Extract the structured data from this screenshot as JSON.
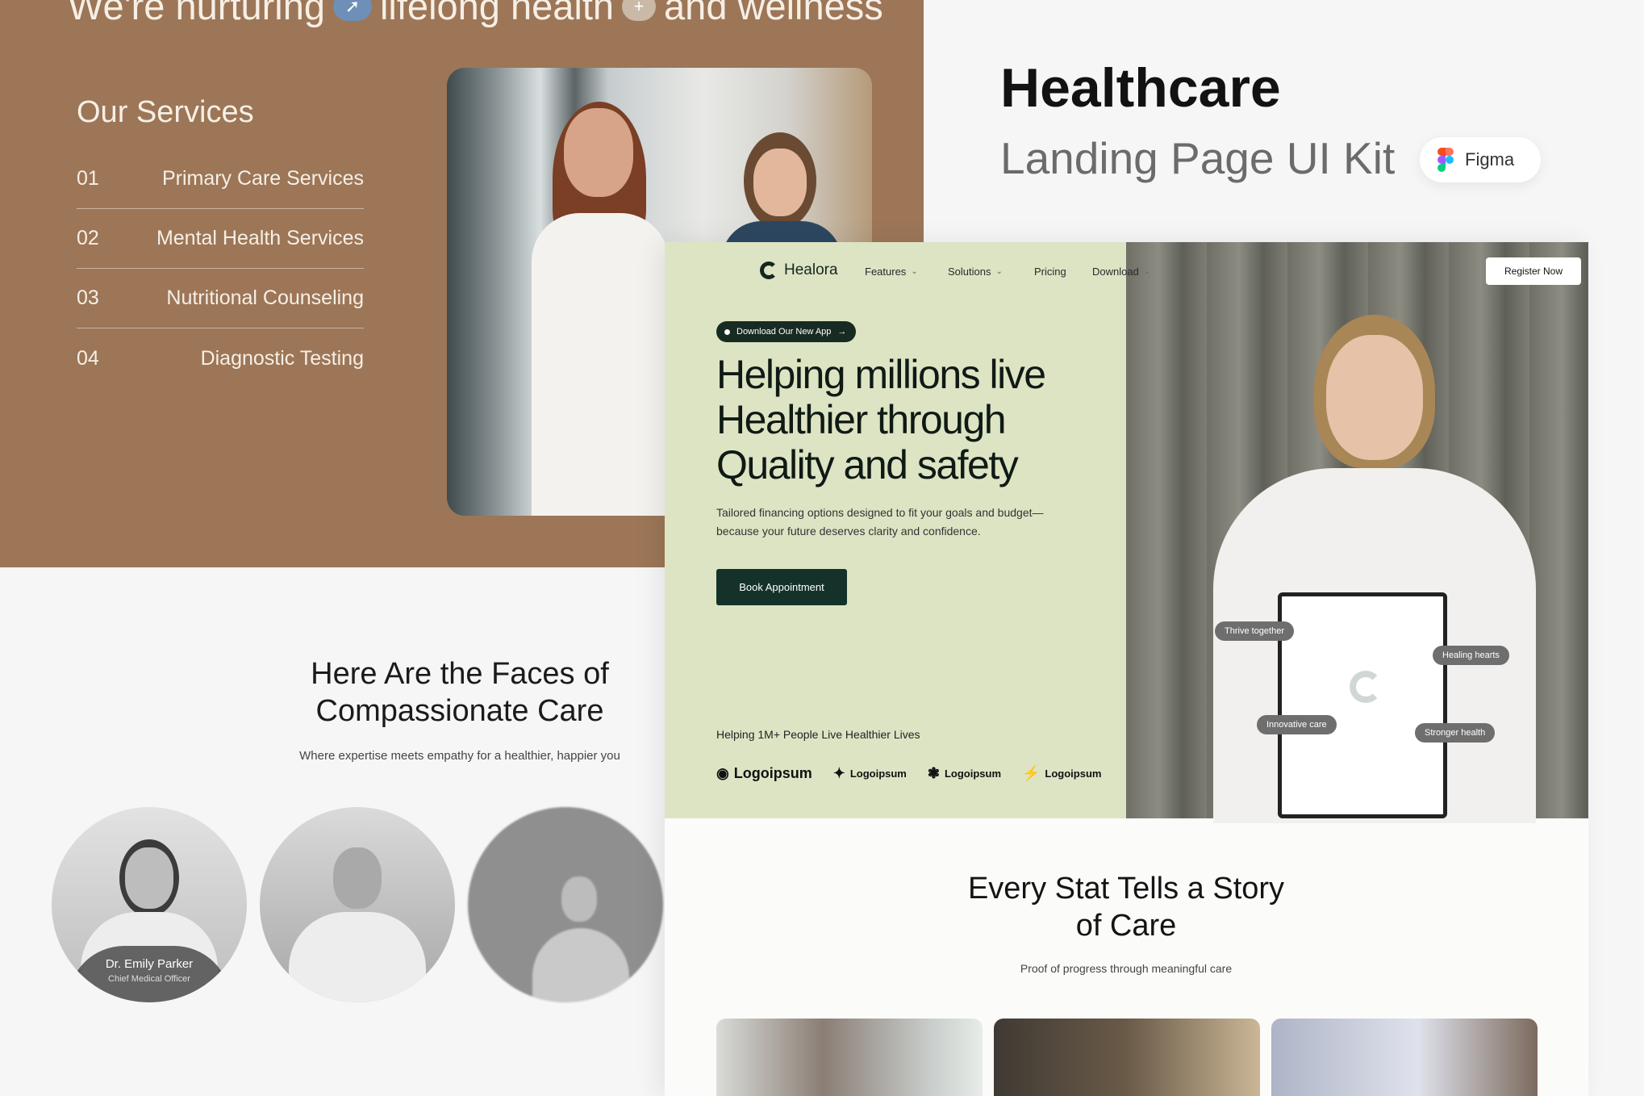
{
  "brown": {
    "headline_part1": "We're nurturing",
    "headline_part2": "lifelong health",
    "headline_part3": "and wellness",
    "services_title": "Our Services",
    "services": [
      {
        "num": "01",
        "label": "Primary Care Services"
      },
      {
        "num": "02",
        "label": "Mental Health Services"
      },
      {
        "num": "03",
        "label": "Nutritional Counseling"
      },
      {
        "num": "04",
        "label": "Diagnostic Testing"
      }
    ]
  },
  "kit": {
    "title": "Healthcare",
    "subtitle": "Landing Page UI Kit",
    "tool": "Figma"
  },
  "faces": {
    "title": "Here Are the Faces of Compassionate Care",
    "subtitle": "Where expertise meets empathy for a healthier, happier you",
    "members": [
      {
        "name": "Dr. Emily Parker",
        "role": "Chief Medical Officer"
      }
    ]
  },
  "landing": {
    "brand": "Healora",
    "nav": [
      "Features",
      "Solutions",
      "Pricing",
      "Download"
    ],
    "register": "Register Now",
    "badge": "Download Our New App",
    "headline": "Helping millions live Healthier through Quality and safety",
    "paragraph": "Tailored financing options designed to fit your goals and budget—because your future deserves clarity and confidence.",
    "cta": "Book Appointment",
    "social_proof": "Helping 1M+ People Live Healthier Lives",
    "logos": [
      "Logoipsum",
      "Logoipsum",
      "Logoipsum",
      "Logoipsum"
    ],
    "tags": [
      "Thrive together",
      "Healing hearts",
      "Innovative care",
      "Stronger health"
    ],
    "stat_title": "Every Stat Tells a Story of Care",
    "stat_subtitle": "Proof of progress through meaningful care"
  },
  "colors": {
    "brown_panel": "#9c7657",
    "hero_green": "#dde4c4",
    "cta_dark": "#143229"
  },
  "icons": [
    "syringe-icon",
    "medical-plus-icon",
    "figma-icon",
    "chevron-down-icon",
    "arrow-right-icon"
  ]
}
